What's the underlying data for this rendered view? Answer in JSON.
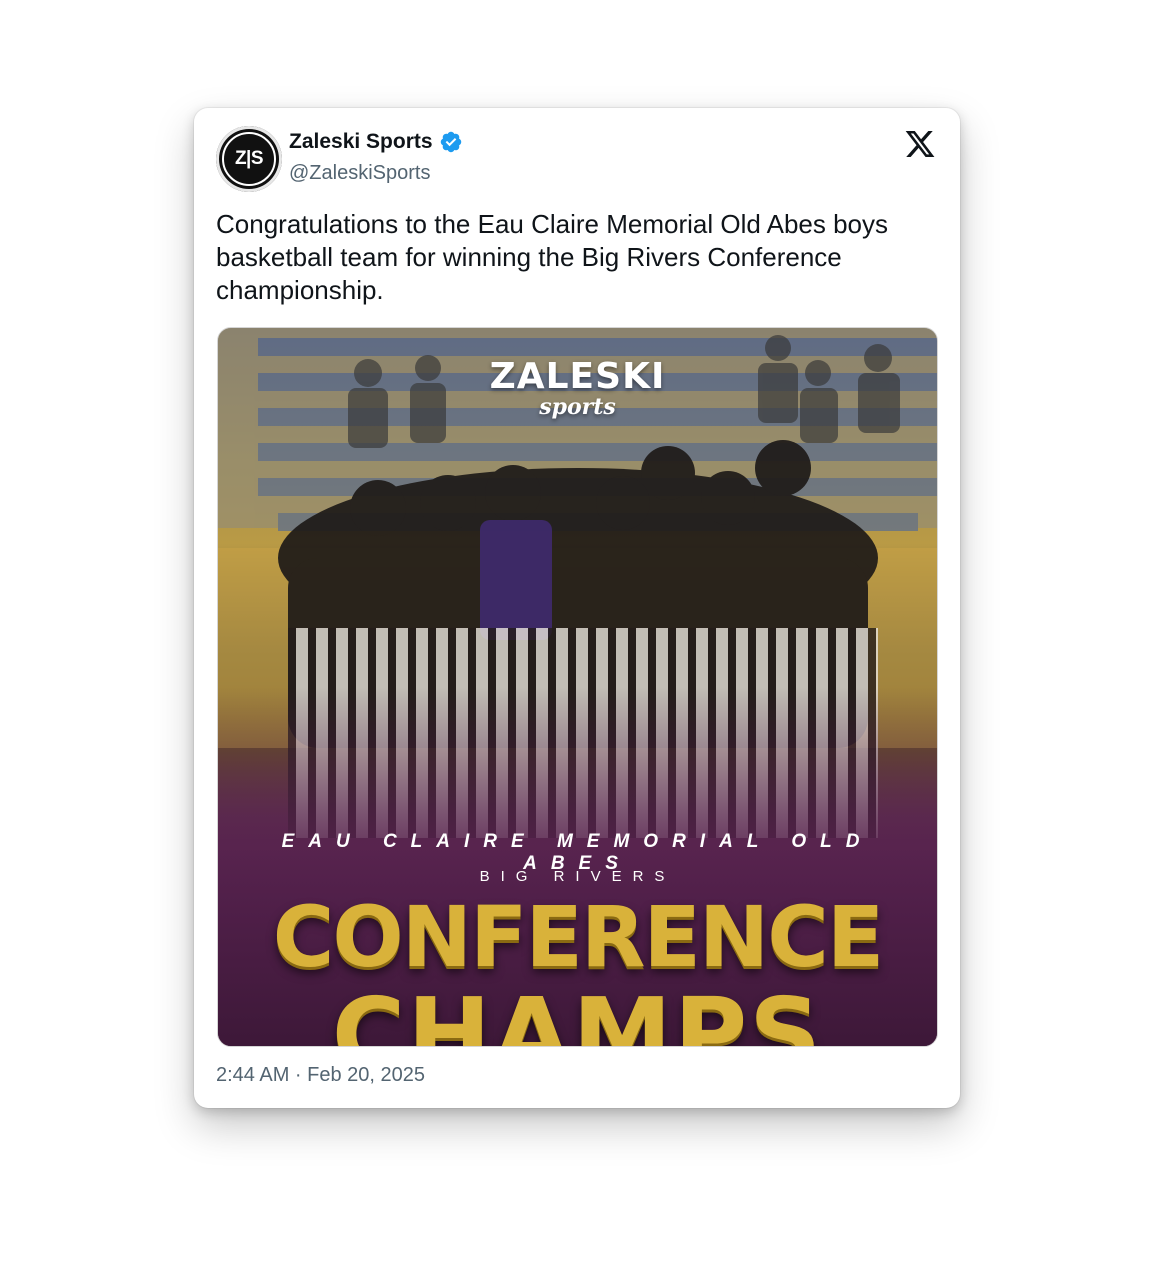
{
  "post": {
    "author": {
      "display_name": "Zaleski Sports",
      "handle": "@ZaleskiSports",
      "avatar_text": "Z|S",
      "verified": true,
      "verified_color": "#1d9bf0"
    },
    "platform_icon": "x-logo-icon",
    "text": "Congratulations to the Eau Claire Memorial Old Abes boys basketball team for winning the Big Rivers Conference championship.",
    "media": {
      "brand_title": "ZALESKI",
      "brand_subtitle": "sports",
      "team_line": "EAU CLAIRE MEMORIAL OLD ABES",
      "league_line": "BIG RIVERS",
      "headline_1": "CONFERENCE",
      "headline_2": "CHAMPS",
      "gold_color": "#d9b23a",
      "purple_color": "#4a1f46"
    },
    "timestamp": "2:44 AM · Feb 20, 2025"
  }
}
